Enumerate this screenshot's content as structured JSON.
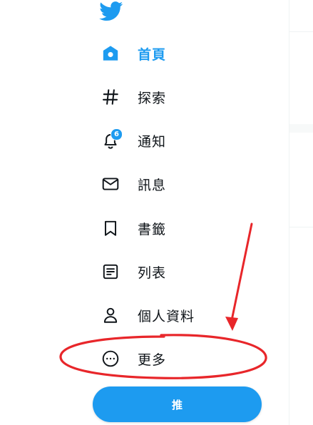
{
  "nav": {
    "items": [
      {
        "label": "首頁",
        "icon": "home-icon",
        "active": true
      },
      {
        "label": "探索",
        "icon": "hashtag-icon"
      },
      {
        "label": "通知",
        "icon": "bell-icon",
        "badge": "6"
      },
      {
        "label": "訊息",
        "icon": "envelope-icon"
      },
      {
        "label": "書籤",
        "icon": "bookmark-icon"
      },
      {
        "label": "列表",
        "icon": "list-icon"
      },
      {
        "label": "個人資料",
        "icon": "person-icon"
      },
      {
        "label": "更多",
        "icon": "more-circle-icon"
      }
    ]
  },
  "tweet_button": {
    "label": "推"
  },
  "colors": {
    "accent": "#1d9bf0",
    "annotation": "#e8262a",
    "text": "#0f1419"
  }
}
